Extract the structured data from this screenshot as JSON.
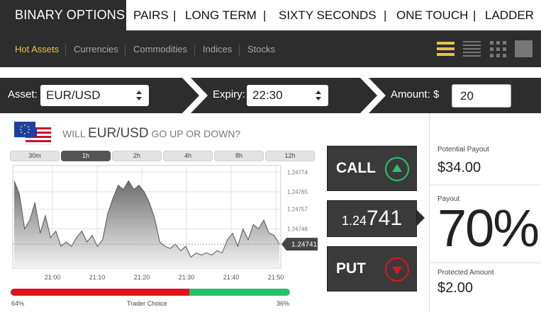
{
  "topnav": {
    "brand": "BINARY OPTIONS",
    "tabs": [
      "PAIRS",
      "LONG TERM",
      "SIXTY SECONDS",
      "ONE TOUCH",
      "LADDER"
    ],
    "separator": "|"
  },
  "subnav": {
    "items": [
      "Hot Assets",
      "Currencies",
      "Commodities",
      "Indices",
      "Stocks"
    ],
    "active": "Hot Assets"
  },
  "controls": {
    "asset_label": "Asset:",
    "asset_value": "EUR/USD",
    "expiry_label": "Expiry:",
    "expiry_value": "22:30",
    "amount_label": "Amount: $",
    "amount_value": "20"
  },
  "question": {
    "prefix": "WILL",
    "asset": "EUR/USD",
    "suffix": "GO UP OR DOWN?"
  },
  "timeframes": [
    "30m",
    "1h",
    "2h",
    "4h",
    "8h",
    "12h"
  ],
  "active_timeframe": "1h",
  "chart_data": {
    "type": "area",
    "x_ticks": [
      "21:00",
      "21:10",
      "21:20",
      "21:30",
      "21:40",
      "21:50"
    ],
    "y_ticks": [
      "1.24774",
      "1.24765",
      "1.24757",
      "1.24748"
    ],
    "current_price_label": "1.24741",
    "ylim": [
      1.2473,
      1.24777
    ],
    "y": [
      1.2477,
      1.24764,
      1.24748,
      1.24752,
      1.2476,
      1.24746,
      1.24754,
      1.24744,
      1.24747,
      1.2474,
      1.24742,
      1.2474,
      1.24744,
      1.24747,
      1.24742,
      1.24745,
      1.2474,
      1.24743,
      1.24755,
      1.24762,
      1.24768,
      1.24766,
      1.2477,
      1.24766,
      1.24768,
      1.24765,
      1.2476,
      1.24753,
      1.24742,
      1.2474,
      1.24739,
      1.24741,
      1.24738,
      1.2474,
      1.24735,
      1.24737,
      1.24736,
      1.24737,
      1.24736,
      1.24738,
      1.24737,
      1.24743,
      1.24746,
      1.2474,
      1.24748,
      1.24743,
      1.2475,
      1.24748,
      1.24752,
      1.24746,
      1.24745,
      1.24741
    ],
    "grid": true
  },
  "trader_choice": {
    "label": "Trader Choice",
    "put_pct": "64%",
    "call_pct": "36%",
    "put_fraction": 0.64,
    "colors": {
      "put": "#e0141e",
      "call": "#27c06a"
    }
  },
  "trade": {
    "call_label": "CALL",
    "put_label": "PUT",
    "price_prefix": "1.24",
    "price_main": "741"
  },
  "payout": {
    "potential_label": "Potential Payout",
    "potential_value": "$34.00",
    "payout_label": "Payout",
    "payout_value": "70%",
    "protected_label": "Protected Amount",
    "protected_value": "$2.00"
  },
  "colors": {
    "accent": "#e5c24a",
    "dark": "#2d2d2d",
    "call": "#2cc16c",
    "put": "#e0141e"
  }
}
